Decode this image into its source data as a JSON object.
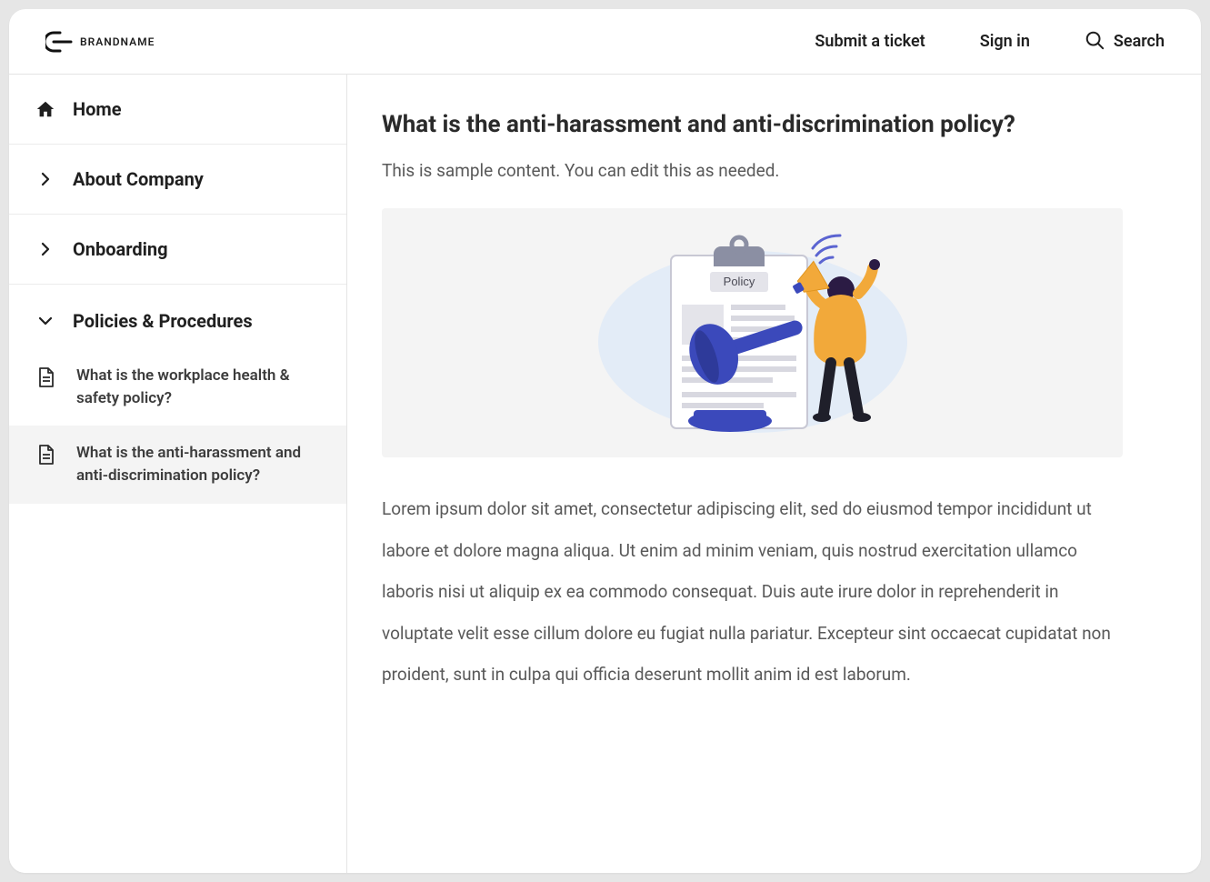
{
  "brand": {
    "name": "BRANDNAME"
  },
  "header": {
    "submit_ticket": "Submit a ticket",
    "sign_in": "Sign in",
    "search": "Search"
  },
  "sidebar": {
    "home": "Home",
    "about": "About Company",
    "onboarding": "Onboarding",
    "policies": "Policies & Procedures",
    "sub": [
      {
        "label": "What is the workplace health & safety policy?"
      },
      {
        "label": "What is the anti-harassment and anti-discrimination policy?"
      }
    ]
  },
  "article": {
    "title": "What is the anti-harassment and anti-discrimination policy?",
    "intro": "This is sample content. You can edit this as needed.",
    "illustration_badge": "Policy",
    "body": "Lorem ipsum dolor sit amet, consectetur adipiscing elit, sed do eiusmod tempor incididunt ut labore et dolore magna aliqua. Ut enim ad minim veniam, quis nostrud exercitation ullamco laboris nisi ut aliquip ex ea commodo consequat. Duis aute irure dolor in reprehenderit in voluptate velit esse cillum dolore eu fugiat nulla pariatur. Excepteur sint occaecat cupidatat non proident, sunt in culpa qui officia deserunt mollit anim id est laborum."
  }
}
